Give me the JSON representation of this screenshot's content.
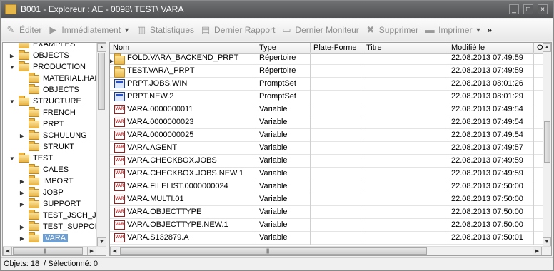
{
  "window": {
    "title": "B001 - Explorer : AE - 0098\\ TEST\\ VARA",
    "title_display": "B001 - Exploreur : AE - 0098\\ TEST\\ VARA"
  },
  "toolbar": {
    "edit_label": "Éditer",
    "run_label": "Immédiatement",
    "stats_label": "Statistiques",
    "last_report_label": "Dernier Rapport",
    "last_monitor_label": "Dernier Moniteur",
    "delete_label": "Supprimer",
    "print_label": "Imprimer",
    "more_label": "»"
  },
  "tree": {
    "items": [
      {
        "label": "EXAMPLES",
        "level": 1,
        "arrow": ""
      },
      {
        "label": "OBJECTS",
        "level": 1,
        "arrow": "▶"
      },
      {
        "label": "PRODUCTION",
        "level": 1,
        "arrow": "▼"
      },
      {
        "label": "MATERIAL.HANI",
        "level": 2,
        "arrow": ""
      },
      {
        "label": "OBJECTS",
        "level": 2,
        "arrow": ""
      },
      {
        "label": "STRUCTURE",
        "level": 1,
        "arrow": "▼"
      },
      {
        "label": "FRENCH",
        "level": 2,
        "arrow": ""
      },
      {
        "label": "PRPT",
        "level": 2,
        "arrow": ""
      },
      {
        "label": "SCHULUNG",
        "level": 2,
        "arrow": "▶"
      },
      {
        "label": "STRUKT",
        "level": 2,
        "arrow": ""
      },
      {
        "label": "TEST",
        "level": 1,
        "arrow": "▼"
      },
      {
        "label": "CALES",
        "level": 2,
        "arrow": ""
      },
      {
        "label": "IMPORT",
        "level": 2,
        "arrow": "▶"
      },
      {
        "label": "JOBP",
        "level": 2,
        "arrow": "▶"
      },
      {
        "label": "SUPPORT",
        "level": 2,
        "arrow": "▶"
      },
      {
        "label": "TEST_JSCH_JOB",
        "level": 2,
        "arrow": ""
      },
      {
        "label": "TEST_SUPPORT",
        "level": 2,
        "arrow": "▶"
      },
      {
        "label": "VARA",
        "level": 2,
        "arrow": "▶",
        "selected": true
      }
    ]
  },
  "table": {
    "columns": [
      "Nom",
      "Type",
      "Plate-Forme",
      "Titre",
      "Modifié le",
      "O"
    ],
    "rows": [
      {
        "name": "FOLD.VARA_BACKEND_PRPT",
        "type": "Répertoire",
        "platform": "",
        "title": "",
        "modified": "22.08.2013 07:49:59",
        "icon": "folder",
        "expand": true
      },
      {
        "name": "TEST.VARA_PRPT",
        "type": "Répertoire",
        "platform": "",
        "title": "",
        "modified": "22.08.2013 07:49:59",
        "icon": "folder"
      },
      {
        "name": "PRPT.JOBS.WIN",
        "type": "PromptSet",
        "platform": "",
        "title": "",
        "modified": "22.08.2013 08:01:26",
        "icon": "prompt"
      },
      {
        "name": "PRPT.NEW.2",
        "type": "PromptSet",
        "platform": "",
        "title": "",
        "modified": "22.08.2013 08:01:29",
        "icon": "prompt"
      },
      {
        "name": "VARA.0000000011",
        "type": "Variable",
        "platform": "",
        "title": "",
        "modified": "22.08.2013 07:49:54",
        "icon": "vara"
      },
      {
        "name": "VARA.0000000023",
        "type": "Variable",
        "platform": "",
        "title": "",
        "modified": "22.08.2013 07:49:54",
        "icon": "vara"
      },
      {
        "name": "VARA.0000000025",
        "type": "Variable",
        "platform": "",
        "title": "",
        "modified": "22.08.2013 07:49:54",
        "icon": "vara"
      },
      {
        "name": "VARA.AGENT",
        "type": "Variable",
        "platform": "",
        "title": "",
        "modified": "22.08.2013 07:49:57",
        "icon": "vara"
      },
      {
        "name": "VARA.CHECKBOX.JOBS",
        "type": "Variable",
        "platform": "",
        "title": "",
        "modified": "22.08.2013 07:49:59",
        "icon": "vara"
      },
      {
        "name": "VARA.CHECKBOX.JOBS.NEW.1",
        "type": "Variable",
        "platform": "",
        "title": "",
        "modified": "22.08.2013 07:49:59",
        "icon": "vara"
      },
      {
        "name": "VARA.FILELIST.0000000024",
        "type": "Variable",
        "platform": "",
        "title": "",
        "modified": "22.08.2013 07:50:00",
        "icon": "vara"
      },
      {
        "name": "VARA.MULTI.01",
        "type": "Variable",
        "platform": "",
        "title": "",
        "modified": "22.08.2013 07:50:00",
        "icon": "vara"
      },
      {
        "name": "VARA.OBJECTTYPE",
        "type": "Variable",
        "platform": "",
        "title": "",
        "modified": "22.08.2013 07:50:00",
        "icon": "vara"
      },
      {
        "name": "VARA.OBJECTTYPE.NEW.1",
        "type": "Variable",
        "platform": "",
        "title": "",
        "modified": "22.08.2013 07:50:00",
        "icon": "vara"
      },
      {
        "name": "VARA.S132879.A",
        "type": "Variable",
        "platform": "",
        "title": "",
        "modified": "22.08.2013 07:50:01",
        "icon": "vara"
      }
    ]
  },
  "status": {
    "objects": "Objets: 18",
    "selected": "/ Sélectionné: 0"
  },
  "icons": {
    "vara_text": "VAR"
  }
}
